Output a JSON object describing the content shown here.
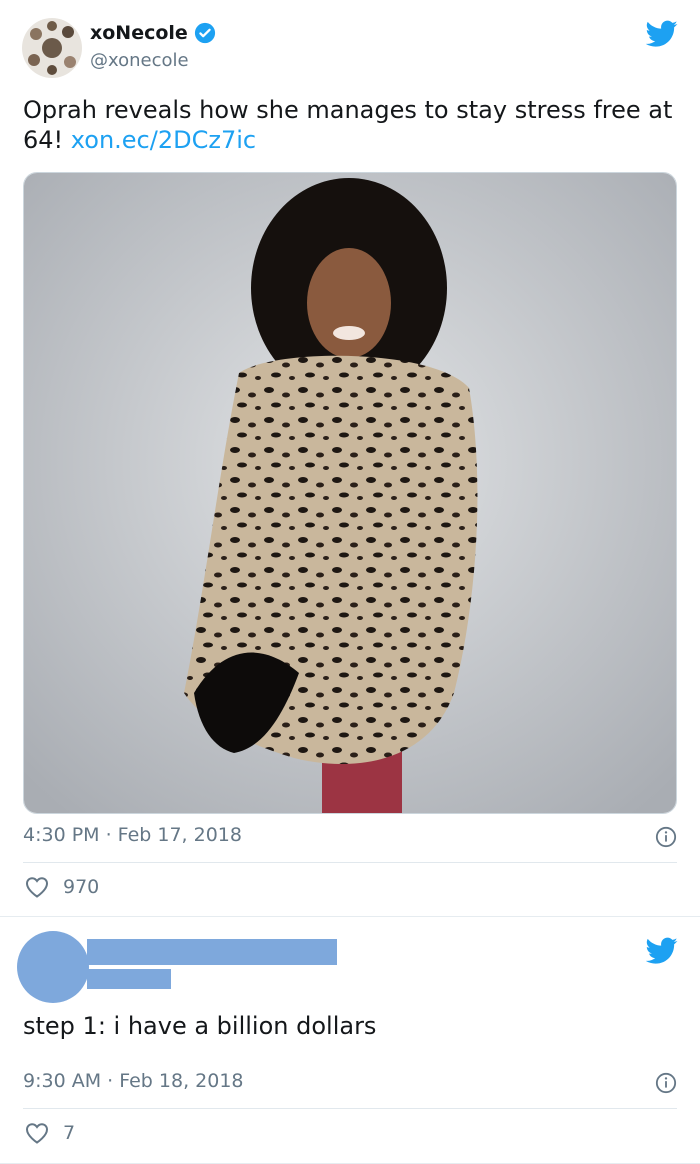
{
  "tweet1": {
    "display_name": "xoNecole",
    "handle": "@xonecole",
    "text": "Oprah reveals how she manages to stay stress free at 64! ",
    "link": "xon.ec/2DCz7ic",
    "timestamp": "4:30 PM · Feb 17, 2018",
    "likes": "970"
  },
  "tweet2": {
    "text": "step 1: i have a billion dollars",
    "timestamp": "9:30 AM · Feb 18, 2018",
    "likes": "7"
  },
  "colors": {
    "twitter_blue": "#1da1f2",
    "redaction": "#7ea8dc",
    "muted": "#657786"
  },
  "icons": [
    "twitter-bird-icon",
    "verified-badge-icon",
    "info-icon",
    "heart-icon"
  ]
}
